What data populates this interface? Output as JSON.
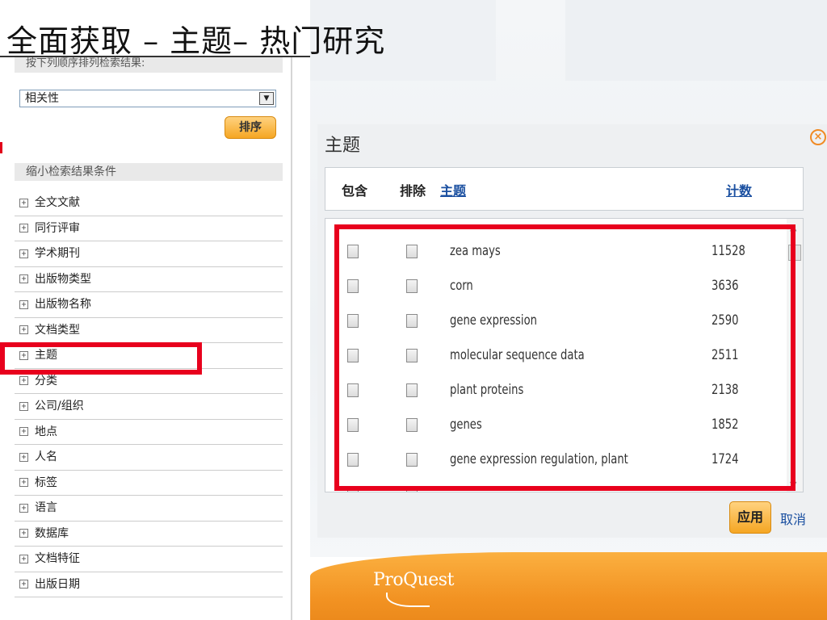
{
  "slide": {
    "title": "全面获取 – 主题– 热门研究"
  },
  "sidebar": {
    "sort_header": "按下列顺序排列检索结果:",
    "sort_select_value": "相关性",
    "sort_button": "排序",
    "narrow_header": "缩小检索结果条件",
    "facets": [
      "全文文献",
      "同行评审",
      "学术期刊",
      "出版物类型",
      "出版物名称",
      "文档类型",
      "主题",
      "分类",
      "公司/组织",
      "地点",
      "人名",
      "标签",
      "语言",
      "数据库",
      "文档特征",
      "出版日期"
    ],
    "highlighted_facet": "主题"
  },
  "dialog": {
    "title": "主题",
    "close_icon": "close-circle-icon",
    "col_include": "包含",
    "col_exclude": "排除",
    "col_subject": "主题",
    "col_count": "计数",
    "rows": [
      {
        "term": "zea mays",
        "count": "11528"
      },
      {
        "term": "corn",
        "count": "3636"
      },
      {
        "term": "gene expression",
        "count": "2590"
      },
      {
        "term": "molecular sequence data",
        "count": "2511"
      },
      {
        "term": "plant proteins",
        "count": "2138"
      },
      {
        "term": "genes",
        "count": "1852"
      },
      {
        "term": "gene expression regulation, plant",
        "count": "1724"
      }
    ],
    "apply_button": "应用",
    "cancel_link": "取消"
  },
  "brand": {
    "logo_text": "ProQuest"
  },
  "colors": {
    "highlight_red": "#e8001d",
    "accent_orange": "#f5a623",
    "link_blue": "#1a4fa0"
  }
}
